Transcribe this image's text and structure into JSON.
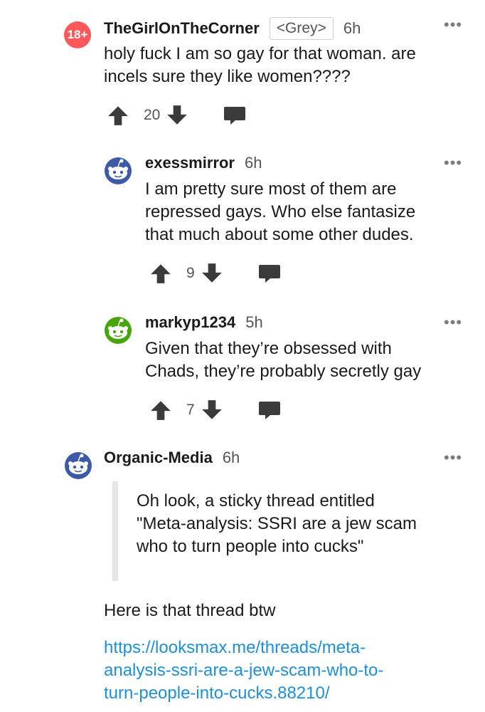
{
  "comments": [
    {
      "badge": "18+",
      "username": "TheGirlOnTheCorner",
      "flair": "<Grey>",
      "age": "6h",
      "body": [
        "holy fuck I am so gay for that woman. are",
        "incels sure they like women????"
      ],
      "score": "20",
      "more": "•••"
    },
    {
      "username": "exessmirror",
      "age": "6h",
      "body": [
        "I am pretty sure most of them are",
        "repressed gays. Who else fantasize",
        "that much about some other dudes."
      ],
      "score": "9",
      "more": "•••",
      "avatar_color": "#3d5aa6"
    },
    {
      "username": "markyp1234",
      "age": "5h",
      "body": [
        "Given that they’re obsessed with",
        "Chads, they’re probably secretly gay"
      ],
      "score": "7",
      "more": "•••",
      "avatar_color": "#46a508"
    },
    {
      "username": "Organic-Media",
      "age": "6h",
      "quote": [
        "Oh look, a sticky thread entitled",
        "\"Meta-analysis: SSRI are a jew scam",
        "who to turn people into cucks\""
      ],
      "body": [
        "Here is that thread btw"
      ],
      "link": [
        "https://looksmax.me/threads/meta-",
        "analysis-ssri-are-a-jew-scam-who-to-",
        "turn-people-into-cucks.88210/"
      ],
      "more": "•••",
      "avatar_color": "#3d5aa6"
    }
  ],
  "colors": {
    "link": "#1d8fdb",
    "badge": "#ff585b",
    "vote_icon": "#3b3b3b"
  }
}
